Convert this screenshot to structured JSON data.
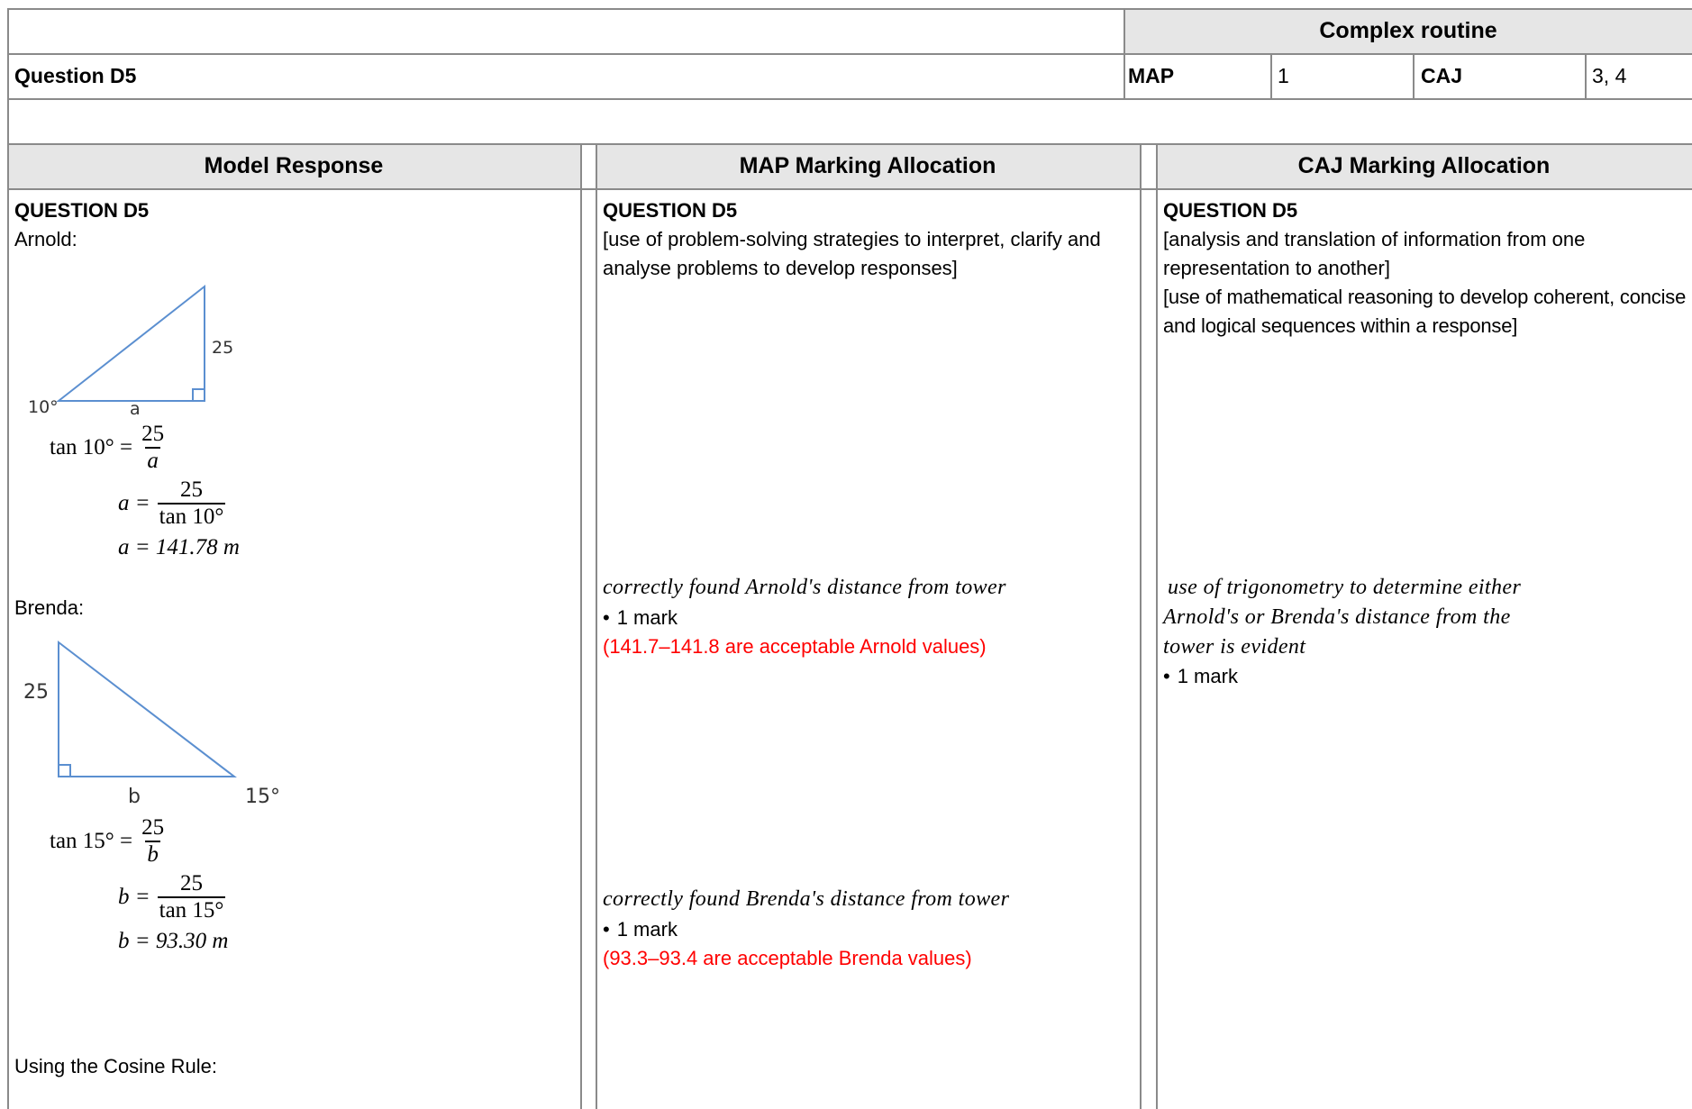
{
  "header": {
    "routine_label": "Complex routine",
    "question_label": "Question D5",
    "map_label": "MAP",
    "map_value": "1",
    "caj_label": "CAJ",
    "caj_value": "3, 4"
  },
  "columns": {
    "model_response": "Model Response",
    "map_allocation": "MAP Marking Allocation",
    "caj_allocation": "CAJ Marking Allocation"
  },
  "model_response": {
    "question": "QUESTION D5",
    "arnold_label": "Arnold:",
    "arnold_triangle": {
      "opposite": "25",
      "angle": "10°",
      "adjacent": "a"
    },
    "arnold_eq1": {
      "lhs": "tan 10° =",
      "num": "25",
      "den": "a"
    },
    "arnold_eq2": {
      "lhs": "a =",
      "num": "25",
      "den": "tan 10°"
    },
    "arnold_eq3": "a = 141.78 m",
    "brenda_label": "Brenda:",
    "brenda_triangle": {
      "opposite": "25",
      "angle": "15°",
      "adjacent": "b"
    },
    "brenda_eq1": {
      "lhs": "tan 15° =",
      "num": "25",
      "den": "b"
    },
    "brenda_eq2": {
      "lhs": "b =",
      "num": "25",
      "den": "tan 15°"
    },
    "brenda_eq3": "b = 93.30 m",
    "cosine_rule": "Using the Cosine Rule:"
  },
  "map_column": {
    "question": "QUESTION D5",
    "criteria": "[use of problem-solving strategies to interpret, clarify and analyse problems to develop responses]",
    "arnold_criterion": "correctly found Arnold's distance from tower",
    "arnold_mark": "1 mark",
    "arnold_note": "(141.7–141.8 are acceptable Arnold values)",
    "brenda_criterion": "correctly found Brenda's distance from tower",
    "brenda_mark": "1 mark",
    "brenda_note": "(93.3–93.4 are acceptable Brenda values)"
  },
  "caj_column": {
    "question": "QUESTION D5",
    "criteria_1": "[analysis and translation of information from one representation to another]",
    "criteria_2": "[use of mathematical reasoning to develop coherent, concise and logical sequences within a response]",
    "criterion_line1": "use of trigonometry to determine either",
    "criterion_line2": "Arnold's or Brenda's distance from the",
    "criterion_line3": "tower is evident",
    "mark": "1 mark"
  },
  "colors": {
    "grid": "#8a8a8a",
    "header_fill": "#e6e6e6",
    "note": "#ff0000",
    "triangle": "#5b8fd0"
  }
}
